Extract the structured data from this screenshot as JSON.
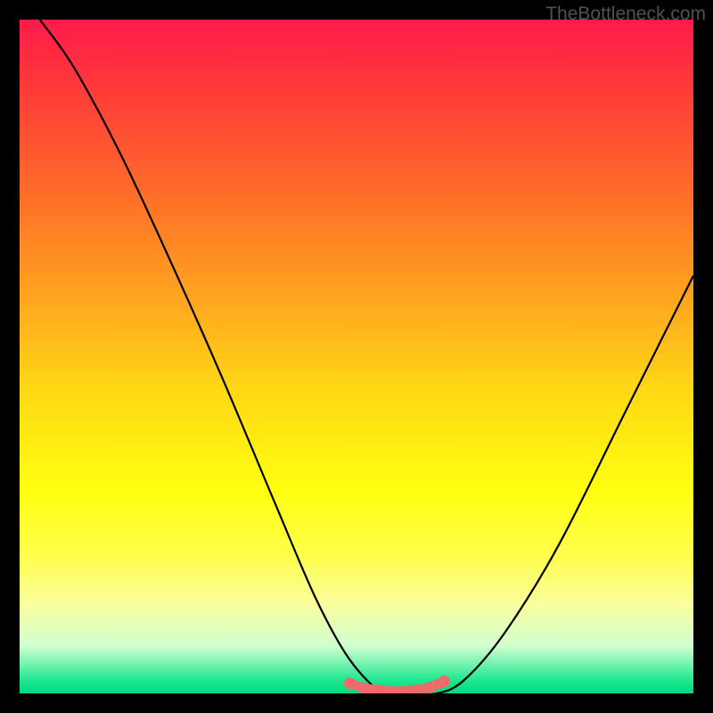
{
  "watermark": "TheBottleneck.com",
  "colors": {
    "background_border": "#000000",
    "curve": "#000000",
    "bottom_markers": "#ef6b6b",
    "gradient_top": "#ff1a4a",
    "gradient_bottom": "#00d880"
  },
  "chart_data": {
    "type": "line",
    "title": "",
    "xlabel": "",
    "ylabel": "",
    "xlim": [
      0,
      100
    ],
    "ylim": [
      0,
      100
    ],
    "grid": false,
    "series": [
      {
        "name": "curve",
        "x": [
          3,
          8,
          15,
          22,
          30,
          38,
          44,
          49,
          54,
          58,
          62,
          66,
          72,
          80,
          90,
          100
        ],
        "y": [
          100,
          93,
          80,
          65,
          47,
          28,
          14,
          5,
          0,
          0,
          0,
          2,
          9,
          22,
          42,
          62
        ]
      },
      {
        "name": "bottom-markers",
        "x": [
          49,
          51,
          53,
          55,
          57,
          59,
          61,
          63
        ],
        "y": [
          1.5,
          0.8,
          0.5,
          0.3,
          0.3,
          0.5,
          0.9,
          1.8
        ]
      }
    ],
    "notes": "Values are approximate percentages estimated from the unlabeled plot. y=0 corresponds to the bottom (green) and y=100 the top (red). The V-shaped curve dips to near zero around x≈54–60."
  }
}
